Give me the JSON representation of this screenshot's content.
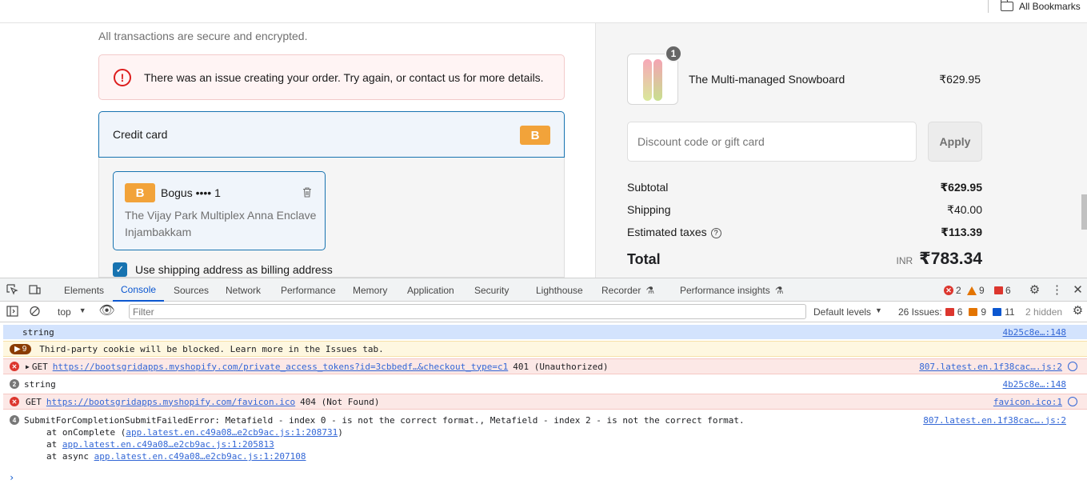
{
  "bookmarks": {
    "all_bookmarks": "All Bookmarks"
  },
  "checkout": {
    "secure_note": "All transactions are secure and encrypted.",
    "error": "There was an issue creating your order. Try again, or contact us for more details.",
    "payment_method": "Credit card",
    "brand_letter": "B",
    "saved_card": {
      "name": "Bogus •••• 1",
      "address": "The Vijay Park Multiplex Anna Enclave Injambakkam"
    },
    "billing_checkbox": "Use shipping address as billing address",
    "billing_checked": true
  },
  "summary": {
    "product": {
      "name": "The Multi-managed Snowboard",
      "price": "₹629.95",
      "quantity": "1"
    },
    "discount_placeholder": "Discount code or gift card",
    "apply": "Apply",
    "subtotal_label": "Subtotal",
    "subtotal": "₹629.95",
    "shipping_label": "Shipping",
    "shipping": "₹40.00",
    "taxes_label": "Estimated taxes",
    "taxes": "₹113.39",
    "total_label": "Total",
    "currency": "INR",
    "total": "₹783.34"
  },
  "devtools": {
    "tabs": [
      "Elements",
      "Console",
      "Sources",
      "Network",
      "Performance",
      "Memory",
      "Application",
      "Security",
      "Lighthouse",
      "Recorder",
      "Performance insights"
    ],
    "active_tab": "Console",
    "counts": {
      "errors": "2",
      "warnings": "9",
      "issues": "6"
    },
    "context": "top",
    "filter_placeholder": "Filter",
    "levels": "Default levels",
    "issues_label": "26 Issues:",
    "issues_red": "6",
    "issues_orange": "9",
    "issues_blue": "11",
    "hidden": "2 hidden",
    "rows": {
      "r1_text": "string",
      "r1_src": "4b25c8e…:148",
      "r2_count": "9",
      "r2_text": "Third-party cookie will be blocked. Learn more in the Issues tab.",
      "r3_prefix": "GET",
      "r3_url": "https://bootsgridapps.myshopify.com/private_access_tokens?id=3cbbedf…&checkout_type=c1",
      "r3_status": "401 (Unauthorized)",
      "r3_src": "807.latest.en.1f38cac….js:2",
      "r4_count": "2",
      "r4_text": "string",
      "r4_src": "4b25c8e…:148",
      "r5_prefix": "GET",
      "r5_url": "https://bootsgridapps.myshopify.com/favicon.ico",
      "r5_status": "404 (Not Found)",
      "r5_src": "favicon.ico:1",
      "r6_count": "4",
      "r6_text": "SubmitForCompletionSubmitFailedError: Metafield - index 0 - is not the correct format., Metafield - index 2 - is not the correct format.",
      "r6_src": "807.latest.en.1f38cac….js:2",
      "t1_pre": "at onComplete (",
      "t1_link": "app.latest.en.c49a08…e2cb9ac.js:1:208731",
      "t1_post": ")",
      "t2_pre": "at ",
      "t2_link": "app.latest.en.c49a08…e2cb9ac.js:1:205813",
      "t3_pre": "at async ",
      "t3_link": "app.latest.en.c49a08…e2cb9ac.js:1:207108"
    }
  },
  "colors": {
    "accent": "#1773b0",
    "brand_badge": "#f2a33a",
    "error": "#dc362e",
    "devtools_active": "#0b57d0"
  }
}
